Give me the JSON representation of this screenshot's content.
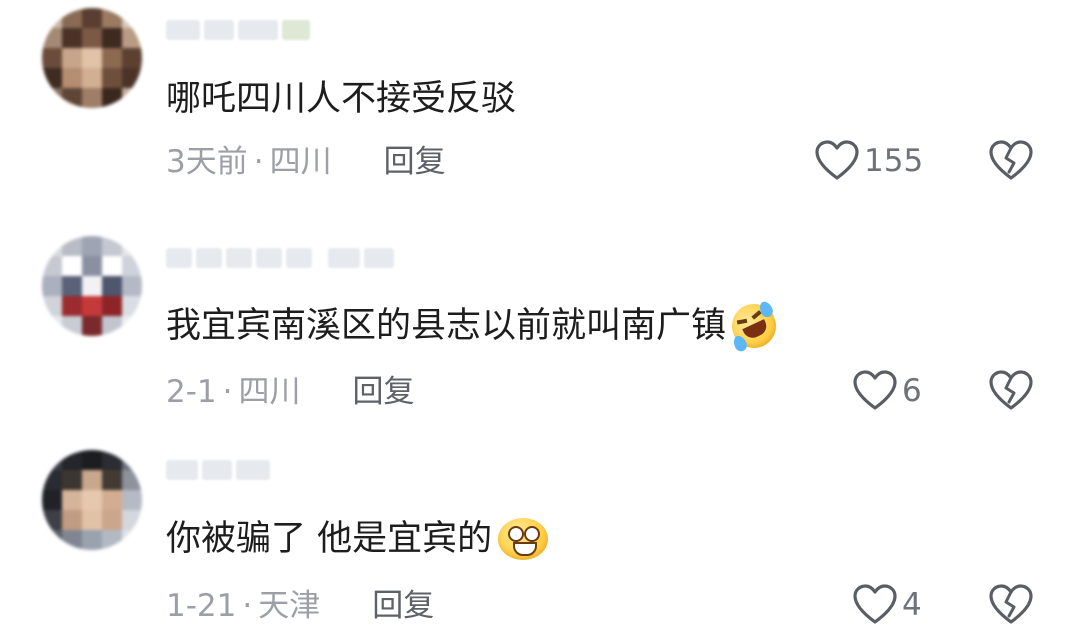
{
  "comments": [
    {
      "text": "哪吒四川人不接受反驳",
      "time": "3天前",
      "separator": "·",
      "location": "四川",
      "reply_label": "回复",
      "likes": "155",
      "emoji": ""
    },
    {
      "text": "我宜宾南溪区的县志以前就叫南广镇",
      "time": "2-1",
      "separator": "·",
      "location": "四川",
      "reply_label": "回复",
      "likes": "6",
      "emoji": "rofl-emoji"
    },
    {
      "text": "你被骗了 他是宜宾的",
      "time": "1-21",
      "separator": "·",
      "location": "天津",
      "reply_label": "回复",
      "likes": "4",
      "emoji": "goofy-grin-emoji"
    }
  ],
  "icons": {
    "like": "heart-outline-icon",
    "dislike": "broken-heart-icon"
  },
  "colors": {
    "meta_text": "#9c9fa5",
    "reply_text": "#5e6168",
    "icon_stroke": "#5a5d63"
  }
}
